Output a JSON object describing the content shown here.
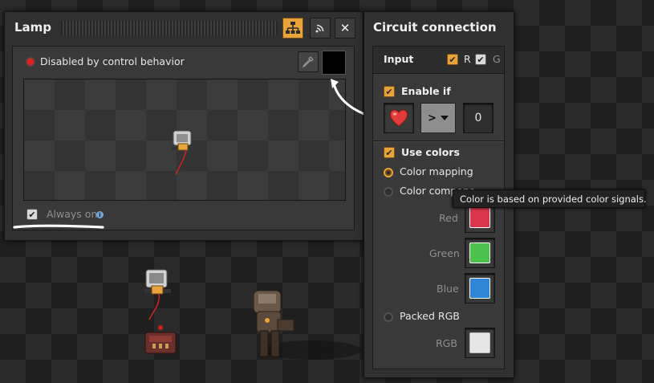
{
  "lamp_panel": {
    "title": "Lamp",
    "status_text": "Disabled by control behavior",
    "always_on_label": "Always on",
    "always_on_checked": true,
    "info_glyph": "i",
    "header_buttons": [
      "circuit-network-icon",
      "wireless-icon",
      "close-icon"
    ],
    "close_glyph": "✕"
  },
  "circuit_panel": {
    "title": "Circuit connection",
    "input_label": "Input",
    "red_label": "R",
    "green_label": "G",
    "enable_if_label": "Enable if",
    "comparator_label": ">",
    "constant_value": "0",
    "use_colors_label": "Use colors",
    "color_mapping_label": "Color mapping",
    "color_components_label": "Color components",
    "red_field_label": "Red",
    "green_field_label": "Green",
    "blue_field_label": "Blue",
    "packed_rgb_label": "Packed RGB",
    "rgb_field_label": "RGB"
  },
  "tooltip": {
    "text": "Color is based on provided color signals."
  },
  "colors": {
    "accent_orange": "#e8a33a",
    "signal_red": "#d9364c",
    "signal_green": "#4cc24c",
    "signal_blue": "#2f86d6",
    "signal_white": "#e6e6e6",
    "status_red": "#e21f1f"
  }
}
